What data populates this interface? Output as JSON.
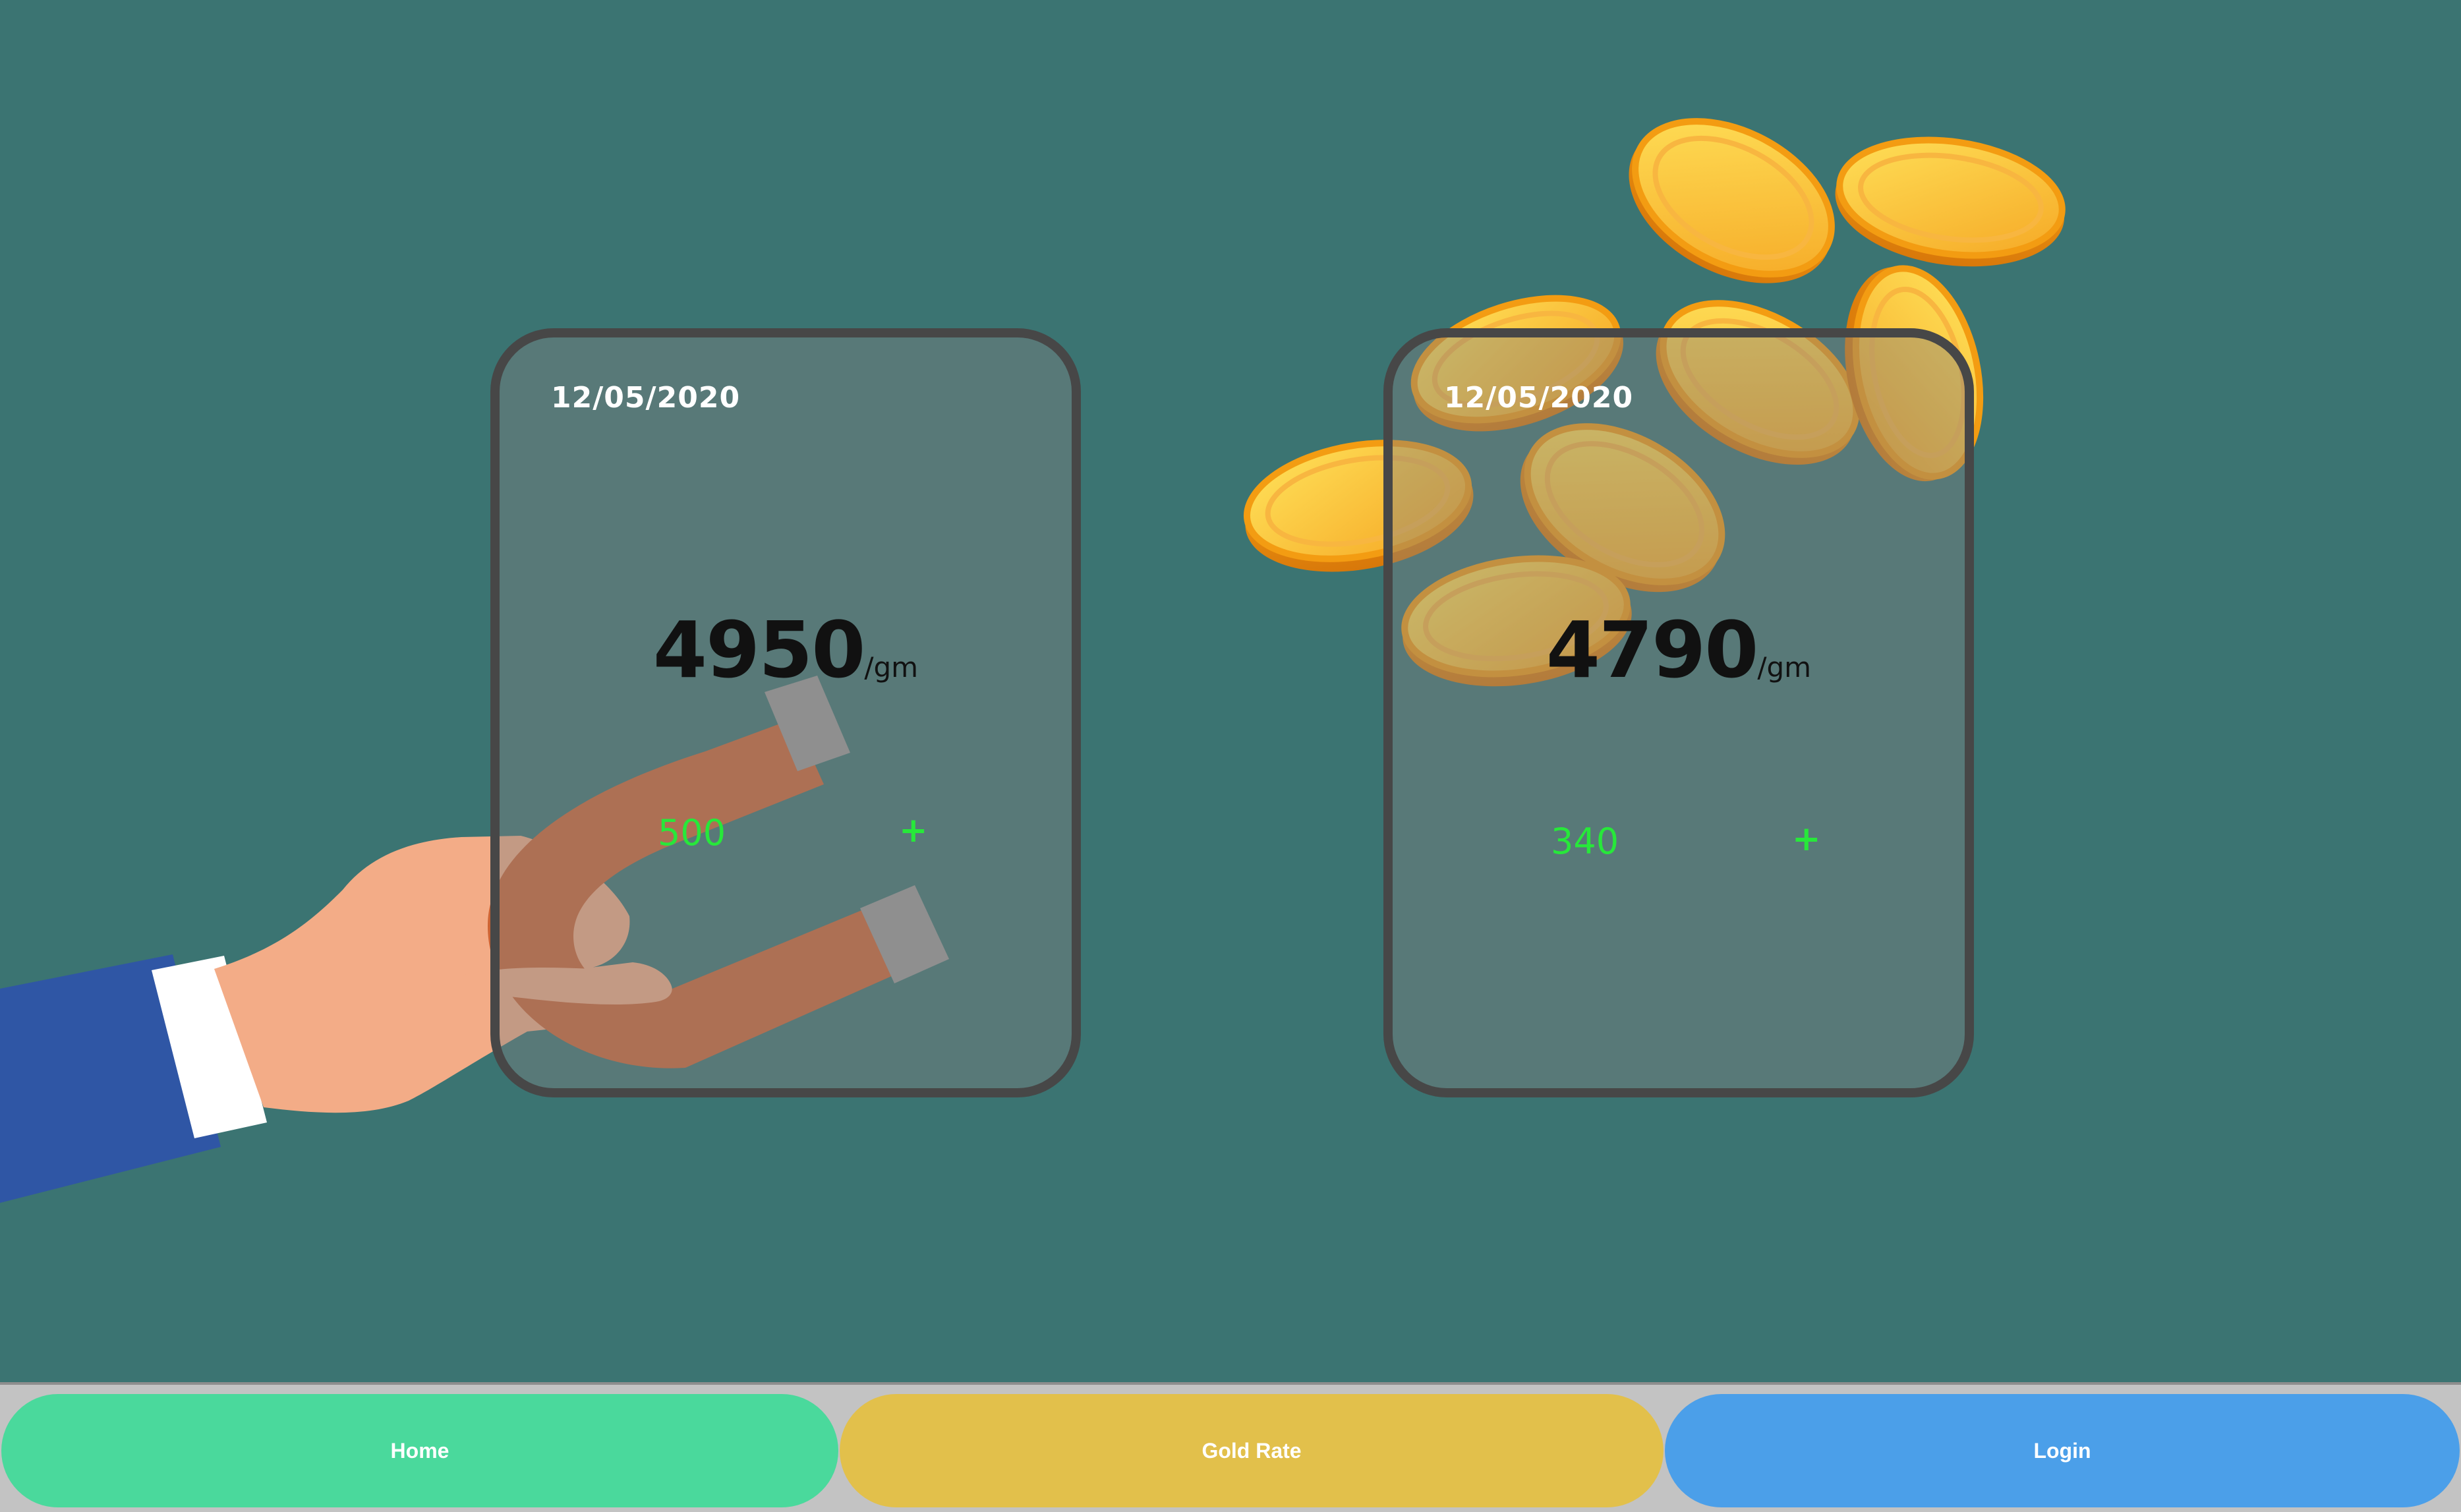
{
  "cards": [
    {
      "date": "12/05/2020",
      "price": "4950",
      "unit": "/gm",
      "change": "500",
      "action": "+"
    },
    {
      "date": "12/05/2020",
      "price": "4790",
      "unit": "/gm",
      "change": "340",
      "action": "+"
    }
  ],
  "nav": {
    "home": "Home",
    "gold_rate": "Gold Rate",
    "login": "Login"
  },
  "colors": {
    "background": "#3b7472",
    "change_text": "#27e83a",
    "home_button": "#4ad99c",
    "gold_rate_button": "#e2c04b",
    "login_button": "#4b9fe9"
  },
  "illustrations": [
    "hand-with-magnet-illustration",
    "gold-coins-illustration"
  ]
}
